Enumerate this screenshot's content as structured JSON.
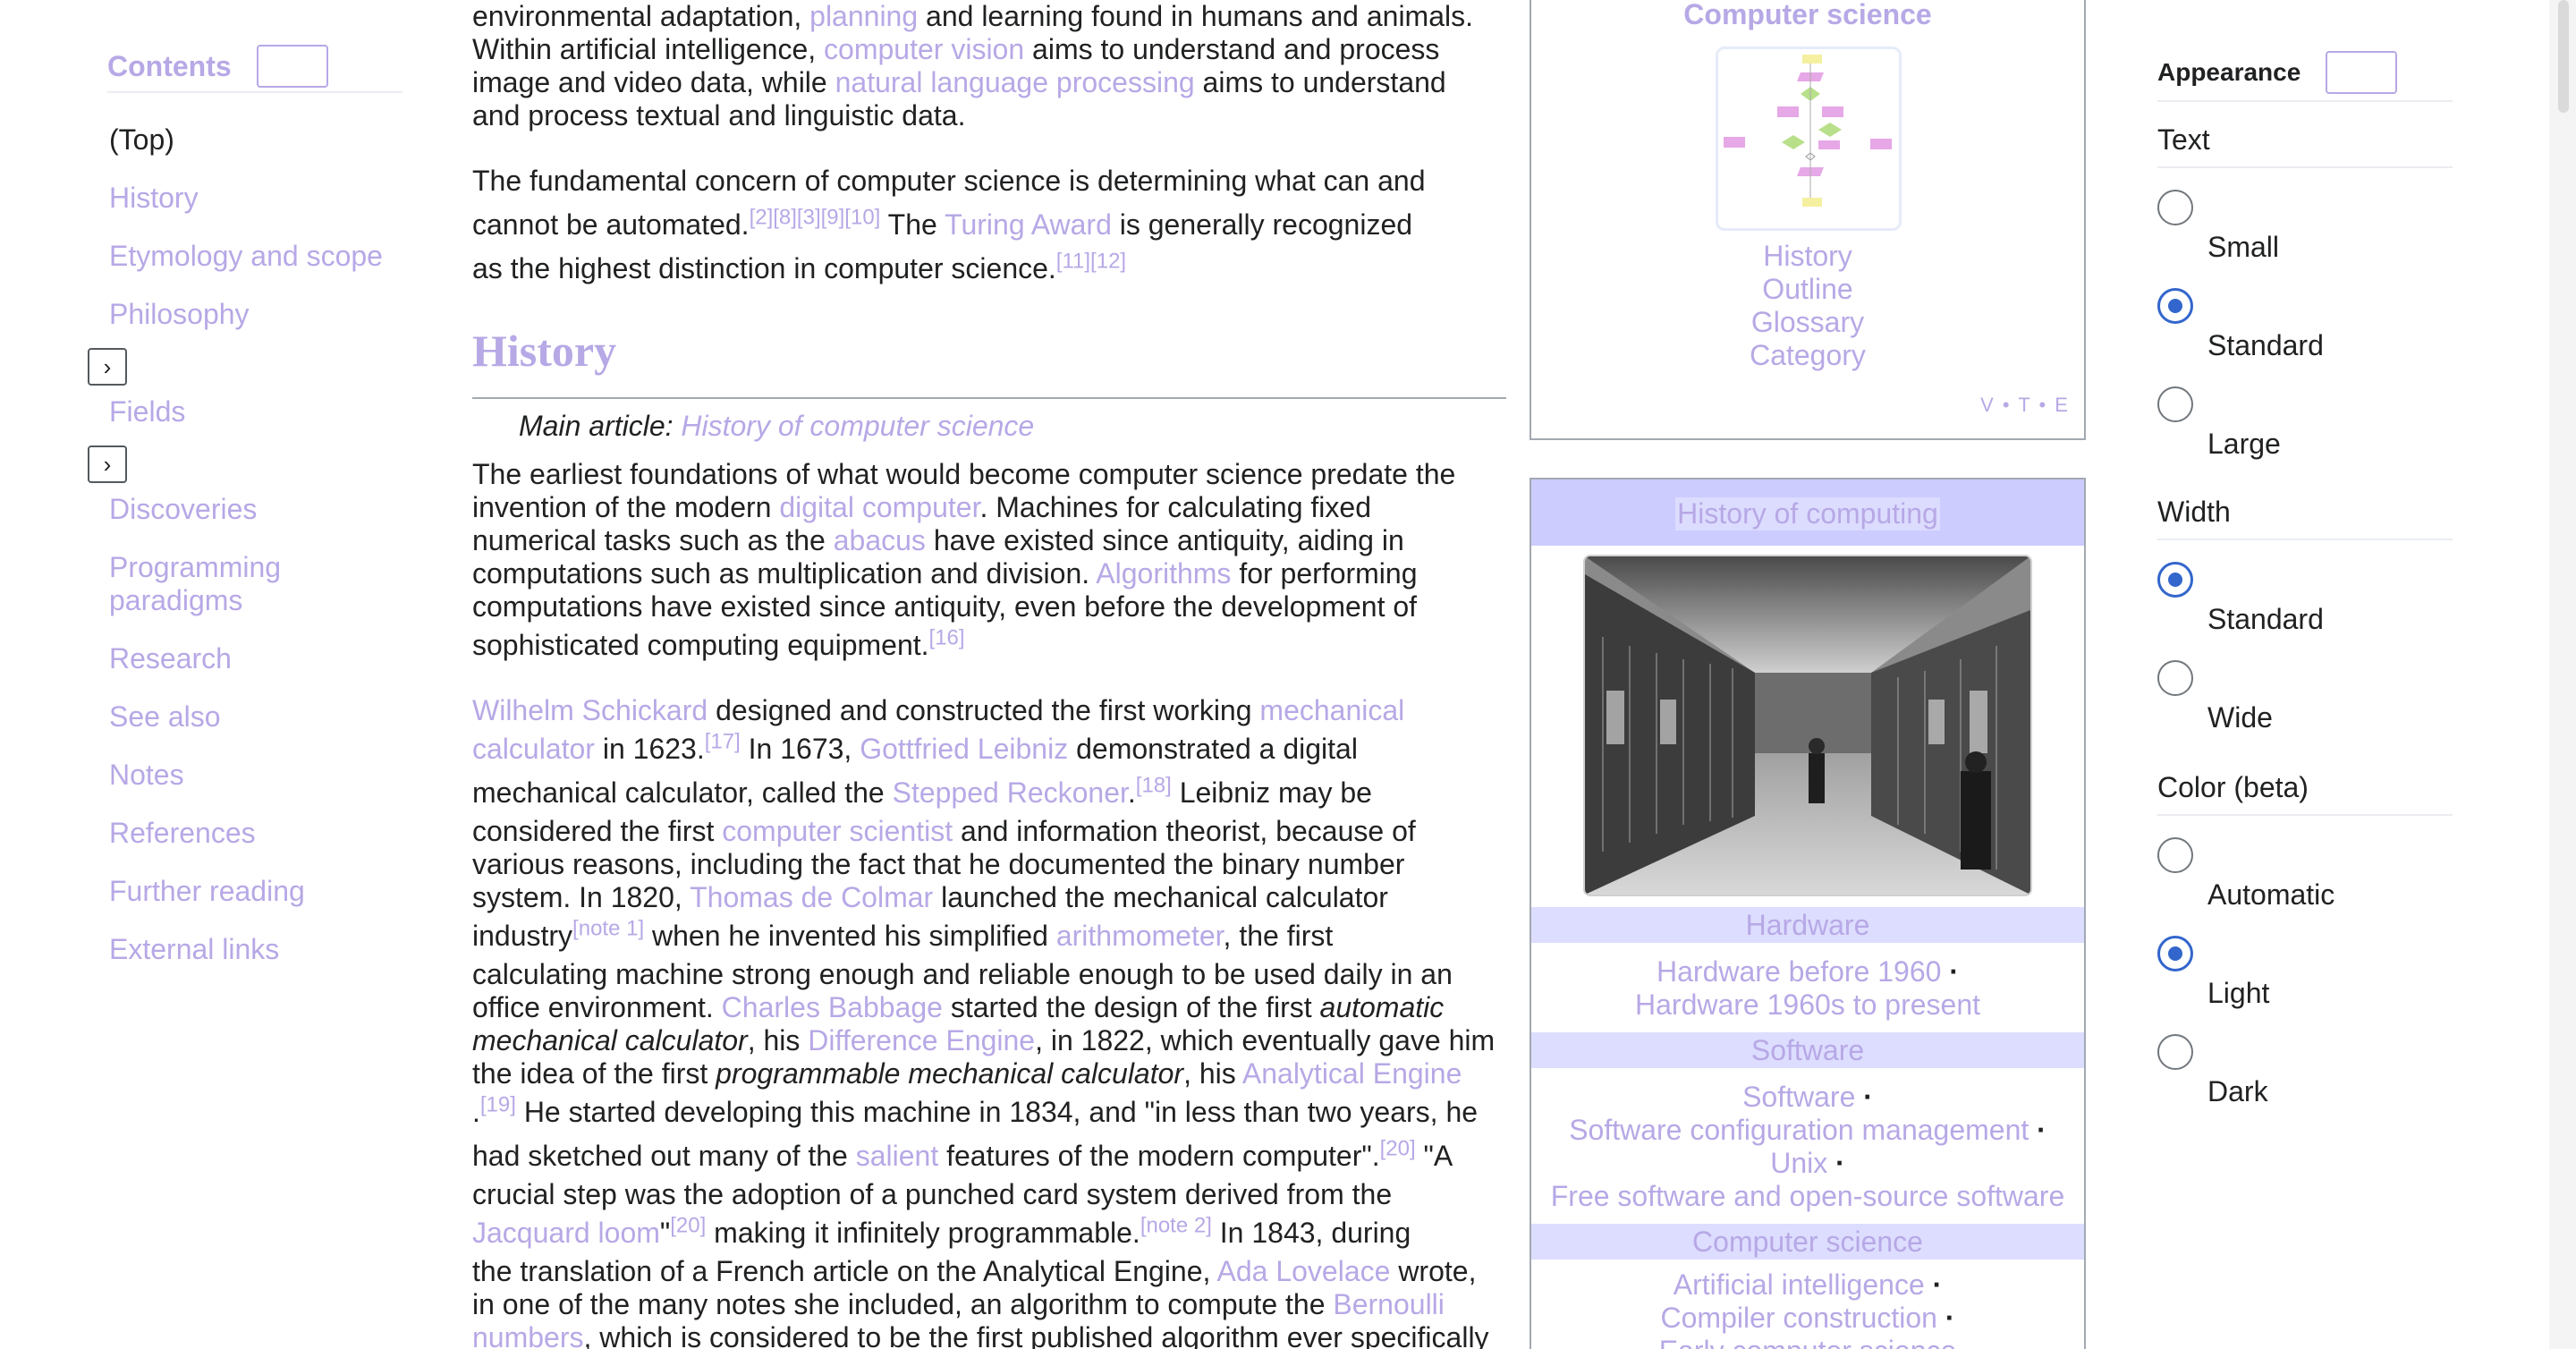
{
  "toc": {
    "title": "Contents",
    "items": [
      "(Top)",
      "History",
      "Etymology and scope",
      "Philosophy",
      "Fields",
      "Discoveries",
      "Programming paradigms",
      "Research",
      "See also",
      "Notes",
      "References",
      "Further reading",
      "External links"
    ],
    "toggle_glyph": "›"
  },
  "article": {
    "intro": {
      "l1a": "environmental adaptation, ",
      "l1b": "planning",
      "l1c": " and learning found in humans and animals.",
      "l2a": "Within artificial intelligence, ",
      "l2b": "computer vision",
      "l2c": " aims to understand and process",
      "l3a": "image and video data, while ",
      "l3b": "natural language processing",
      "l3c": " aims to understand",
      "l4": "and process textual and linguistic data."
    },
    "p2": {
      "l1": "The fundamental concern of computer science is determining what can and",
      "l2a": "cannot be automated.",
      "refs1": "[2][8][3][9][10]",
      "l2b": " The ",
      "l2c": "Turing Award",
      "l2d": " is generally recognized",
      "l3a": "as the highest distinction in computer science.",
      "refs2": "[11][12]"
    },
    "history_heading": "History",
    "hatnote_label": "Main article: ",
    "hatnote_link": "History of computer science",
    "p3": {
      "l1": "The earliest foundations of what would become computer science predate the",
      "l2a": "invention of the modern ",
      "l2b": "digital computer",
      "l2c": ". Machines for calculating fixed",
      "l3a": "numerical tasks such as the ",
      "l3b": "abacus",
      "l3c": " have existed since antiquity, aiding in",
      "l4a": "computations such as multiplication and division. ",
      "l4b": "Algorithms",
      "l4c": " for performing",
      "l5": "computations have existed since antiquity, even before the development of",
      "l6": "sophisticated computing equipment.",
      "ref": "[16]"
    },
    "p4": {
      "l1a": "Wilhelm Schickard",
      "l1b": " designed and constructed the first working ",
      "l1c": "mechanical",
      "l2a": "calculator",
      "l2b": " in 1623.",
      "r17": "[17]",
      "l2c": " In 1673, ",
      "l2d": "Gottfried Leibniz",
      "l2e": " demonstrated a digital",
      "l3a": "mechanical calculator, called the ",
      "l3b": "Stepped Reckoner",
      "l3c": ".",
      "r18": "[18]",
      "l3d": " Leibniz may be",
      "l4a": "considered the first ",
      "l4b": "computer scientist",
      "l4c": " and information theorist, because of",
      "l5": "various reasons, including the fact that he documented the binary number",
      "l6a": "system. In 1820, ",
      "l6b": "Thomas de Colmar",
      "l6c": " launched the mechanical calculator",
      "l7a": "industry",
      "rn1": "[note 1]",
      "l7b": " when he invented his simplified ",
      "l7c": "arithmometer",
      "l7d": ", the first",
      "l8": "calculating machine strong enough and reliable enough to be used daily in an",
      "l9a": "office environment. ",
      "l9b": "Charles Babbage",
      "l9c": " started the design of the first ",
      "l9d": "automatic",
      "l10a": "mechanical calculator",
      "l10b": ", his ",
      "l10c": "Difference Engine",
      "l10d": ", in 1822, which eventually gave him",
      "l11a": "the idea of the first ",
      "l11b": "programmable mechanical calculator",
      "l11c": ", his ",
      "l11d": "Analytical Engine",
      "l12a": ".",
      "r19": "[19]",
      "l12b": " He started developing this machine in 1834, and \"in less than two years, he",
      "l13a": "had sketched out many of the ",
      "l13b": "salient",
      "l13c": " features of the modern computer\".",
      "r20a": "[20]",
      "l13d": " \"A",
      "l14": "crucial step was the adoption of a punched card system derived from the",
      "l15a": "Jacquard loom",
      "l15b": "\"",
      "r20b": "[20]",
      "l15c": " making it infinitely programmable.",
      "rn2": "[note 2]",
      "l15d": " In 1843, during",
      "l16a": "the translation of a French article on the Analytical Engine, ",
      "l16b": "Ada Lovelace",
      "l16c": " wrote,",
      "l17a": "in one of the many notes she included, an algorithm to compute the ",
      "l17b": "Bernoulli",
      "l18a": "numbers",
      "l18b": ", which is considered to be the first published algorithm ever specifically"
    }
  },
  "navbox1": {
    "title": "Computer science",
    "links": [
      "History",
      "Outline",
      "Glossary",
      "Category"
    ],
    "vte": "V • T • E"
  },
  "navbox2": {
    "title": "History of computing",
    "hardware_header": "Hardware",
    "hardware_line1": "Hardware before 1960",
    "hardware_line2": "Hardware 1960s to present",
    "software_header": "Software",
    "software_items": [
      "Software",
      "Software configuration management",
      "Unix",
      "Free software and open-source software"
    ],
    "cs_header": "Computer science",
    "cs_items": [
      "Artificial intelligence",
      "Compiler construction",
      "Early computer science"
    ],
    "separator": "·"
  },
  "appearance": {
    "title": "Appearance",
    "text_heading": "Text",
    "text_options": [
      "Small",
      "Standard",
      "Large"
    ],
    "text_selected": "Standard",
    "width_heading": "Width",
    "width_options": [
      "Standard",
      "Wide"
    ],
    "width_selected": "Standard",
    "color_heading": "Color (beta)",
    "color_options": [
      "Automatic",
      "Light",
      "Dark"
    ],
    "color_selected": "Light"
  },
  "colors": {
    "link": "#b7a8e6",
    "text": "#202122",
    "accent": "#3366cc",
    "navbox_header": "#ccccff",
    "navbox_group": "#ddddff"
  }
}
